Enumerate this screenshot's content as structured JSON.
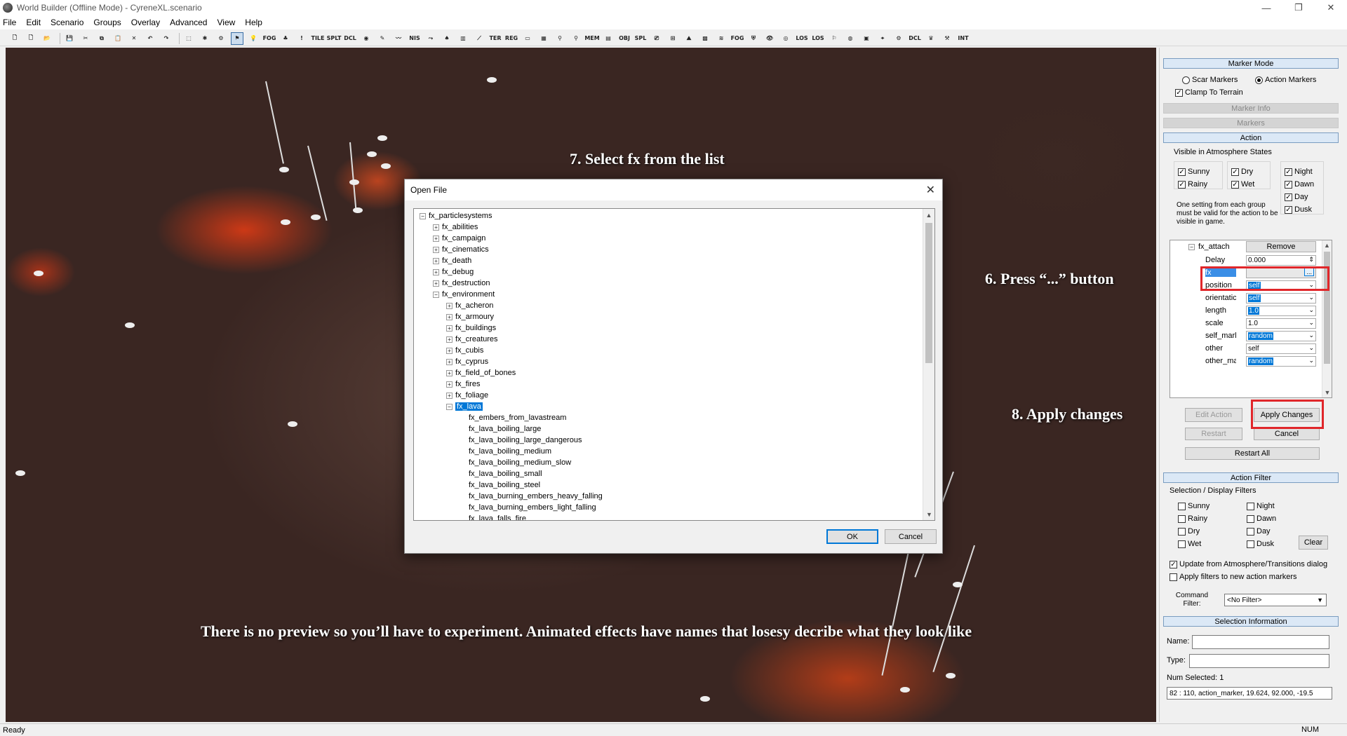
{
  "window": {
    "title": "World Builder (Offline Mode) - CyreneXL.scenario",
    "controls": [
      "—",
      "❐",
      "✕"
    ]
  },
  "menu": [
    "File",
    "Edit",
    "Scenario",
    "Groups",
    "Overlay",
    "Advanced",
    "View",
    "Help"
  ],
  "toolbar_labels": [
    "FOG",
    "TILE",
    "SPLT",
    "DCL",
    "NIS",
    "TER",
    "REG",
    "MEM",
    "OBJ",
    "SPL",
    "FOG",
    "LOS",
    "LOS",
    "DCL",
    "INT"
  ],
  "annotations": {
    "step7": "7. Select fx from the list",
    "step6": "6. Press “...” button",
    "step8": "8. Apply changes",
    "note": "There is no preview so you’ll have to experiment. Animated effects have names that losesy decribe what they look like"
  },
  "dialog": {
    "title": "Open File",
    "tree": [
      {
        "label": "fx_particlesystems",
        "level": 0,
        "exp": "−"
      },
      {
        "label": "fx_abilities",
        "level": 1,
        "exp": "+"
      },
      {
        "label": "fx_campaign",
        "level": 1,
        "exp": "+"
      },
      {
        "label": "fx_cinematics",
        "level": 1,
        "exp": "+"
      },
      {
        "label": "fx_death",
        "level": 1,
        "exp": "+"
      },
      {
        "label": "fx_debug",
        "level": 1,
        "exp": "+"
      },
      {
        "label": "fx_destruction",
        "level": 1,
        "exp": "+"
      },
      {
        "label": "fx_environment",
        "level": 1,
        "exp": "−"
      },
      {
        "label": "fx_acheron",
        "level": 2,
        "exp": "+"
      },
      {
        "label": "fx_armoury",
        "level": 2,
        "exp": "+"
      },
      {
        "label": "fx_buildings",
        "level": 2,
        "exp": "+"
      },
      {
        "label": "fx_creatures",
        "level": 2,
        "exp": "+"
      },
      {
        "label": "fx_cubis",
        "level": 2,
        "exp": "+"
      },
      {
        "label": "fx_cyprus",
        "level": 2,
        "exp": "+"
      },
      {
        "label": "fx_field_of_bones",
        "level": 2,
        "exp": "+"
      },
      {
        "label": "fx_fires",
        "level": 2,
        "exp": "+"
      },
      {
        "label": "fx_foliage",
        "level": 2,
        "exp": "+"
      },
      {
        "label": "fx_lava",
        "level": 2,
        "exp": "−",
        "selected": true
      },
      {
        "label": "fx_embers_from_lavastream",
        "level": 3,
        "exp": ""
      },
      {
        "label": "fx_lava_boiling_large",
        "level": 3,
        "exp": ""
      },
      {
        "label": "fx_lava_boiling_large_dangerous",
        "level": 3,
        "exp": ""
      },
      {
        "label": "fx_lava_boiling_medium",
        "level": 3,
        "exp": ""
      },
      {
        "label": "fx_lava_boiling_medium_slow",
        "level": 3,
        "exp": ""
      },
      {
        "label": "fx_lava_boiling_small",
        "level": 3,
        "exp": ""
      },
      {
        "label": "fx_lava_boiling_steel",
        "level": 3,
        "exp": ""
      },
      {
        "label": "fx_lava_burning_embers_heavy_falling",
        "level": 3,
        "exp": ""
      },
      {
        "label": "fx_lava_burning_embers_light_falling",
        "level": 3,
        "exp": ""
      },
      {
        "label": "fx_lava_falls_fire",
        "level": 3,
        "exp": ""
      }
    ],
    "ok": "OK",
    "cancel": "Cancel"
  },
  "panel": {
    "marker_mode": "Marker Mode",
    "scar_markers": "Scar Markers",
    "action_markers": "Action Markers",
    "clamp_to_terrain": "Clamp To Terrain",
    "marker_info": "Marker Info",
    "markers": "Markers",
    "action": "Action",
    "visible_in_atmo": "Visible in Atmosphere States",
    "states": {
      "sunny": "Sunny",
      "rainy": "Rainy",
      "dry": "Dry",
      "wet": "Wet",
      "night": "Night",
      "dawn": "Dawn",
      "day": "Day",
      "dusk": "Dusk"
    },
    "atmo_note": "One setting from each group must be valid for the action to be visible in game.",
    "fx_attach": "fx_attach",
    "remove": "Remove",
    "props": [
      {
        "name": "Delay",
        "value": "0.000",
        "hl": false
      },
      {
        "name": "fx",
        "value": "",
        "hl": false
      },
      {
        "name": "position",
        "value": "self",
        "hl": true
      },
      {
        "name": "orientatic",
        "value": "self",
        "hl": true
      },
      {
        "name": "length",
        "value": "1.0",
        "hl": true
      },
      {
        "name": "scale",
        "value": "1.0",
        "hl": false
      },
      {
        "name": "self_marl",
        "value": "random",
        "hl": true
      },
      {
        "name": "other",
        "value": "self",
        "hl": false
      },
      {
        "name": "other_ma",
        "value": "random",
        "hl": true
      }
    ],
    "browse_btn": "...",
    "edit_action": "Edit Action",
    "apply_changes": "Apply Changes",
    "restart": "Restart",
    "cancel": "Cancel",
    "restart_all": "Restart All",
    "action_filter": "Action Filter",
    "selection_display_filters": "Selection / Display Filters",
    "clear": "Clear",
    "update_from_atmo": "Update from Atmosphere/Transitions dialog",
    "apply_filters_new": "Apply filters to new action markers",
    "command_filter_label": "Command Filter:",
    "command_filter_value": "<No Filter>",
    "selection_information": "Selection Information",
    "name_label": "Name:",
    "type_label": "Type:",
    "num_selected": "Num Selected: 1",
    "selection_line": "82 : 110, action_marker, 19.624, 92.000, -19.5"
  },
  "status": {
    "left": "Ready",
    "right": "NUM"
  }
}
